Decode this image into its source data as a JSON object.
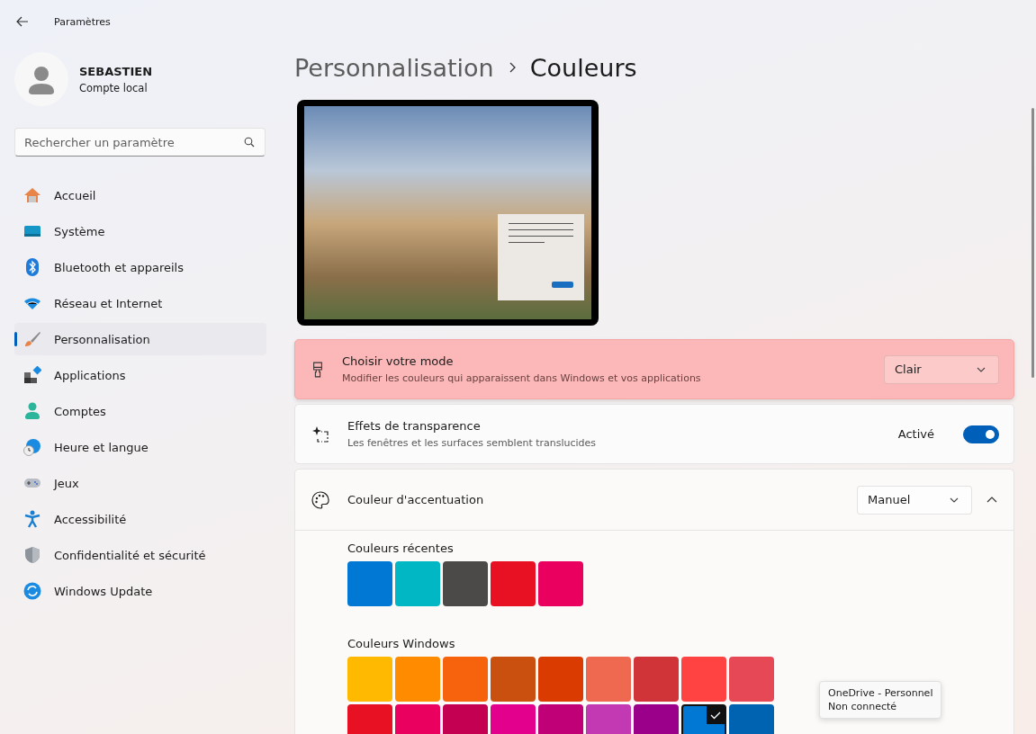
{
  "window": {
    "title": "Paramètres"
  },
  "account": {
    "name": "SEBASTIEN",
    "type": "Compte local"
  },
  "search": {
    "placeholder": "Rechercher un paramètre"
  },
  "sidebar": {
    "items": [
      {
        "label": "Accueil",
        "selected": false
      },
      {
        "label": "Système",
        "selected": false
      },
      {
        "label": "Bluetooth et appareils",
        "selected": false
      },
      {
        "label": "Réseau et Internet",
        "selected": false
      },
      {
        "label": "Personnalisation",
        "selected": true
      },
      {
        "label": "Applications",
        "selected": false
      },
      {
        "label": "Comptes",
        "selected": false
      },
      {
        "label": "Heure et langue",
        "selected": false
      },
      {
        "label": "Jeux",
        "selected": false
      },
      {
        "label": "Accessibilité",
        "selected": false
      },
      {
        "label": "Confidentialité et sécurité",
        "selected": false
      },
      {
        "label": "Windows Update",
        "selected": false
      }
    ]
  },
  "breadcrumb": [
    "Personnalisation",
    "Couleurs"
  ],
  "settings": [
    {
      "kind": "dropdown",
      "title": "Choisir votre mode",
      "description": "Modifier les couleurs qui apparaissent dans Windows et vos applications",
      "value": "Clair",
      "highlighted": true
    },
    {
      "kind": "toggle",
      "title": "Effets de transparence",
      "description": "Les fenêtres et les surfaces semblent translucides",
      "value": "Activé",
      "on": true,
      "highlighted": false
    }
  ],
  "accent": {
    "title": "Couleur d'accentuation",
    "value": "Manuel",
    "expanded": true,
    "recent": {
      "label": "Couleurs récentes",
      "swatches": [
        {
          "color": "#0078d4",
          "selected": false
        },
        {
          "color": "#00b7c3",
          "selected": false
        },
        {
          "color": "#4c4a48",
          "selected": false
        },
        {
          "color": "#e81123",
          "selected": false
        },
        {
          "color": "#ea005e",
          "selected": false
        }
      ]
    },
    "windows": {
      "label": "Couleurs Windows",
      "swatches": [
        {
          "color": "#ffb900",
          "selected": false
        },
        {
          "color": "#ff8c00",
          "selected": false
        },
        {
          "color": "#f7630c",
          "selected": false
        },
        {
          "color": "#ca5010",
          "selected": false
        },
        {
          "color": "#da3b01",
          "selected": false
        },
        {
          "color": "#ef6950",
          "selected": false
        },
        {
          "color": "#d13438",
          "selected": false
        },
        {
          "color": "#ff4343",
          "selected": false
        },
        {
          "color": "#e74856",
          "selected": false
        },
        {
          "color": "#e81123",
          "selected": false
        },
        {
          "color": "#ea005e",
          "selected": false
        },
        {
          "color": "#c30052",
          "selected": false
        },
        {
          "color": "#e3008c",
          "selected": false
        },
        {
          "color": "#bf0077",
          "selected": false
        },
        {
          "color": "#c239b3",
          "selected": false
        },
        {
          "color": "#9a0089",
          "selected": false
        },
        {
          "color": "#0078d4",
          "selected": true
        },
        {
          "color": "#0063b1",
          "selected": false
        }
      ]
    }
  },
  "tooltip": {
    "lines": [
      "OneDrive - Personnel",
      "Non connecté"
    ]
  }
}
